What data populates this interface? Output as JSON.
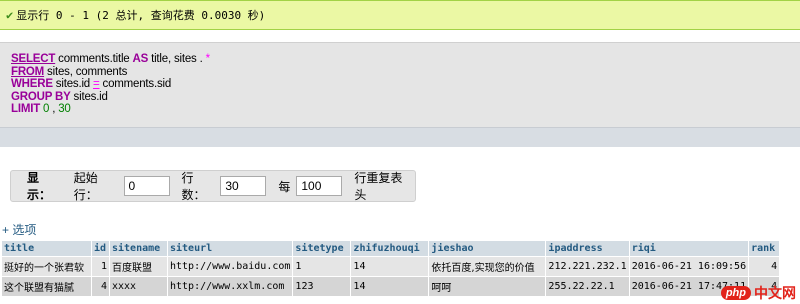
{
  "status": {
    "message": "显示行 0 - 1 (2 总计, 查询花费 0.0030 秒)"
  },
  "sql": {
    "line1": {
      "kw": "SELECT",
      "text": " comments.title ",
      "kw2": "AS",
      "text2": " title, sites . ",
      "star": "*"
    },
    "line2": {
      "kw": "FROM",
      "text": " sites, comments"
    },
    "line3": {
      "kw": "WHERE",
      "text": " sites.id ",
      "op": "=",
      "text2": " comments.sid"
    },
    "line4": {
      "kw": "GROUP BY",
      "text": " sites.id"
    },
    "line5": {
      "kw": "LIMIT",
      "num1": " 0",
      "sep": " , ",
      "num2": "30"
    }
  },
  "nav": {
    "show_label": "显示：",
    "start_row_label": "起始行：",
    "start_row_value": "0",
    "row_count_label": "行数：",
    "row_count_value": "30",
    "every_label": "每",
    "repeat_value": "100",
    "repeat_suffix": "行重复表头"
  },
  "options_link": "+ 选项",
  "table": {
    "headers": [
      "title",
      "id",
      "sitename",
      "siteurl",
      "sitetype",
      "zhifuzhouqi",
      "jieshao",
      "ipaddress",
      "riqi",
      "rank"
    ],
    "rows": [
      [
        "挺好的一个张君软",
        "1",
        "百度联盟",
        "http://www.baidu.com",
        "1",
        "14",
        "依托百度,实现您的价值",
        "212.221.232.1",
        "2016-06-21 16:09:56",
        "4"
      ],
      [
        "这个联盟有猫腻",
        "4",
        "xxxx",
        "http://www.xxlm.com",
        "123",
        "14",
        "呵呵",
        "255.22.22.1",
        "2016-06-21 17:47:11",
        "4"
      ]
    ]
  },
  "watermark": {
    "logo": "php",
    "text": "中文网"
  },
  "colors": {
    "success_bg": "#ebf8a4",
    "sql_keyword": "#990099",
    "header_bg": "#d3dce3",
    "link": "#235a81"
  }
}
